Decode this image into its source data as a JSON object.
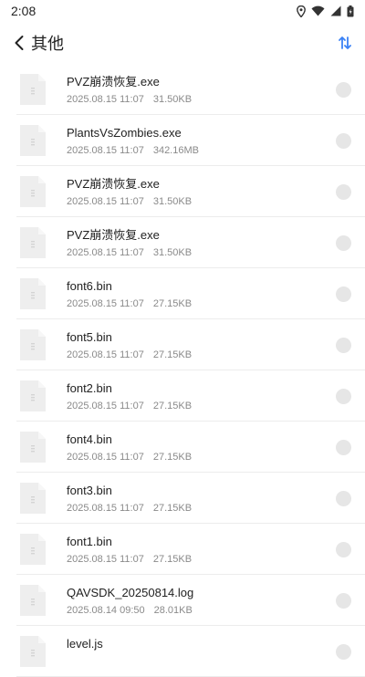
{
  "status_bar": {
    "time": "2:08",
    "icons": [
      "location-icon",
      "wifi-icon",
      "signal-icon",
      "battery-icon"
    ]
  },
  "header": {
    "back_icon": "chevron-left-icon",
    "title": "其他",
    "sort_icon": "sort-icon",
    "accent_color": "#3b82f6"
  },
  "files": [
    {
      "name": "PVZ崩溃恢复.exe",
      "date": "2025.08.15 11:07",
      "size": "31.50KB"
    },
    {
      "name": "PlantsVsZombies.exe",
      "date": "2025.08.15 11:07",
      "size": "342.16MB"
    },
    {
      "name": "PVZ崩溃恢复.exe",
      "date": "2025.08.15 11:07",
      "size": "31.50KB"
    },
    {
      "name": "PVZ崩溃恢复.exe",
      "date": "2025.08.15 11:07",
      "size": "31.50KB"
    },
    {
      "name": "font6.bin",
      "date": "2025.08.15 11:07",
      "size": "27.15KB"
    },
    {
      "name": "font5.bin",
      "date": "2025.08.15 11:07",
      "size": "27.15KB"
    },
    {
      "name": "font2.bin",
      "date": "2025.08.15 11:07",
      "size": "27.15KB"
    },
    {
      "name": "font4.bin",
      "date": "2025.08.15 11:07",
      "size": "27.15KB"
    },
    {
      "name": "font3.bin",
      "date": "2025.08.15 11:07",
      "size": "27.15KB"
    },
    {
      "name": "font1.bin",
      "date": "2025.08.15 11:07",
      "size": "27.15KB"
    },
    {
      "name": "QAVSDK_20250814.log",
      "date": "2025.08.14 09:50",
      "size": "28.01KB"
    },
    {
      "name": "level.js",
      "date": "",
      "size": ""
    }
  ]
}
